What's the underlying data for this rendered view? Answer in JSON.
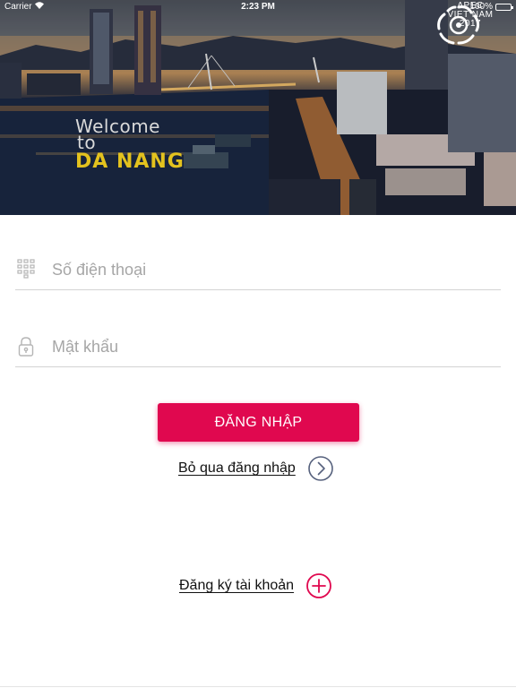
{
  "status_bar": {
    "carrier": "Carrier",
    "time": "2:23 PM",
    "battery": "100%"
  },
  "banner": {
    "welcome_line1": "Welcome",
    "welcome_line2": "to",
    "city": "DA NANG",
    "apec_line1": "APEC",
    "apec_line2": "VIET NAM",
    "apec_line3": "2017"
  },
  "form": {
    "phone_placeholder": "Số điện thoại",
    "phone_value": "",
    "password_placeholder": "Mật khẩu",
    "password_value": "",
    "login_label": "ĐĂNG NHẬP",
    "skip_label": "Bỏ qua đăng nhập",
    "register_label": "Đăng ký tài khoản"
  },
  "colors": {
    "accent": "#e0084f",
    "skip_icon": "#56617d",
    "field_icon": "#b5b5b5",
    "divider": "#d3d3d3",
    "placeholder": "#a6a6a6"
  },
  "icons": {
    "phone_field": "keypad-icon",
    "password_field": "lock-icon",
    "skip": "chevron-right-circle-icon",
    "register": "plus-circle-icon",
    "status_wifi": "wifi-icon"
  }
}
